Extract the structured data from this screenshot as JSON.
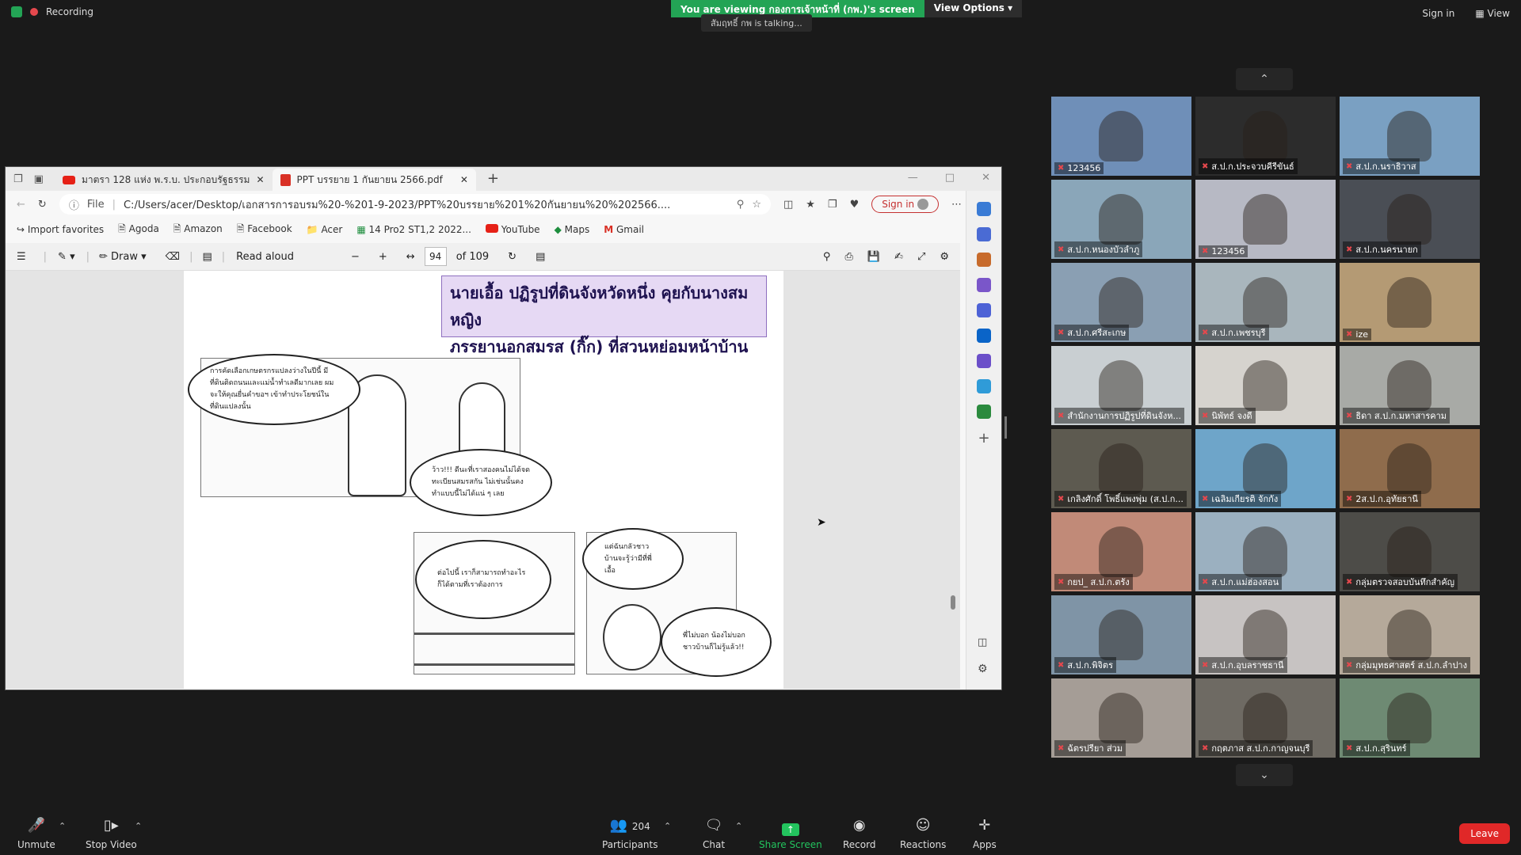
{
  "top": {
    "recording_label": "Recording",
    "banner_view": "You are viewing กองการเจ้าหน้าที่ (กพ.)'s screen",
    "banner_options": "View Options",
    "talking": "สัมฤทธิ์ กพ is talking...",
    "sign_in": "Sign in",
    "view": "View"
  },
  "browser": {
    "tabs": [
      {
        "label": "มาตรา 128 แห่ง พ.ร.บ. ประกอบรัฐธรรม",
        "icon": "youtube-icon"
      },
      {
        "label": "PPT บรรยาย 1 กันยายน 2566.pdf",
        "icon": "pdf-icon"
      }
    ],
    "file_label": "File",
    "url": "C:/Users/acer/Desktop/เอกสารการอบรม%20-%201-9-2023/PPT%20บรรยาย%201%20กันยายน%20%202566....",
    "signin": "Sign in",
    "favorites": [
      "Import favorites",
      "Agoda",
      "Amazon",
      "Facebook",
      "Acer",
      "14 Pro2 ST1,2 2022...",
      "YouTube",
      "Maps",
      "Gmail"
    ],
    "pdf_toolbar": {
      "draw": "Draw",
      "read_aloud": "Read aloud",
      "page_number": "94",
      "page_total": "of 109"
    }
  },
  "slide": {
    "title_line1": "นายเอื้อ ปฏิรูปที่ดินจังหวัดหนึ่ง คุยกับนางสมหญิง",
    "title_line2": "ภรรยานอกสมรส (กิ๊ก) ที่สวนหย่อมหน้าบ้าน",
    "bubble1": "การคัดเลือกเกษตรกรแปลงว่างในปีนี้ มีที่ดินติดถนนและแม่น้ำทำเลดีมากเลย ผมจะให้คุณยื่นคำขอฯ เข้าทำประโยชน์ในที่ดินแปลงนั้น",
    "bubble2": "ว้าว!!! ดีนะที่เราสองคนไม่ได้จดทะเบียนสมรสกัน ไม่เช่นนั้นคงทำแบบนี้ไม่ได้แน่ ๆ เลย",
    "bubble3": "ต่อไปนี้ เราก็สามารถทำอะไรก็ได้ตามที่เราต้องการ",
    "bubble4": "แต่ฉันกลัวชาวบ้านจะรู้ว่ามีที่พี่เอื้อ",
    "bubble5": "พี่ไม่บอก น้องไม่บอก ชาวบ้านก็ไม่รู้แล้ว!!"
  },
  "participants": [
    {
      "name": "123456",
      "color": "#6f8fb8"
    },
    {
      "name": "ส.ป.ก.ประจวบคีรีขันธ์",
      "color": "#2c2c2c"
    },
    {
      "name": "ส.ป.ก.นราธิวาส",
      "color": "#7aa0c2"
    },
    {
      "name": "ส.ป.ก.หนองบัวลำภู",
      "color": "#8aa6b9"
    },
    {
      "name": "123456",
      "color": "#b7b9c4"
    },
    {
      "name": "ส.ป.ก.นครนายก",
      "color": "#4a4e55"
    },
    {
      "name": "ส.ป.ก.ศรีสะเกษ",
      "color": "#8a9fb3"
    },
    {
      "name": "ส.ป.ก.เพชรบุรี",
      "color": "#a9b6bd"
    },
    {
      "name": "ize",
      "color": "#b49a74"
    },
    {
      "name": "สำนักงานการปฏิรูปที่ดินจังห...",
      "color": "#c9cfd2"
    },
    {
      "name": "นิพัทธ์ จงดี",
      "color": "#d6d3ce"
    },
    {
      "name": "ธิดา ส.ป.ก.มหาสารคาม",
      "color": "#a8aaa6"
    },
    {
      "name": "เกลิงศักดิ์ โพธิ์แพงพุ่ม (ส.ป.ก...",
      "color": "#5d5a50"
    },
    {
      "name": "เฉลิมเกียรติ จักกัง",
      "color": "#6ea5c9"
    },
    {
      "name": "2ส.ป.ก.อุทัยธานี",
      "color": "#8f6c4c"
    },
    {
      "name": "กยป_ ส.ป.ก.ตรัง",
      "color": "#c18a78"
    },
    {
      "name": "ส.ป.ก.แม่ฮ่องสอน",
      "color": "#9bb0c0"
    },
    {
      "name": "กลุ่มตรวจสอบบันทึกสำคัญ",
      "color": "#4d4c48"
    },
    {
      "name": "ส.ป.ก.พิจิตร",
      "color": "#7f94a6"
    },
    {
      "name": "ส.ป.ก.อุบลราชธานี",
      "color": "#c7c3c2"
    },
    {
      "name": "กลุ่มมุทธศาสตร์ ส.ป.ก.ลำปาง",
      "color": "#b5a99a"
    },
    {
      "name": "ฉัตรปรียา ส่วม",
      "color": "#a59d96"
    },
    {
      "name": "กฤตภาส ส.ป.ก.กาญจนบุรี",
      "color": "#6e6a63"
    },
    {
      "name": "ส.ป.ก.สุรินทร์",
      "color": "#6e8a73"
    }
  ],
  "controls": {
    "unmute": "Unmute",
    "stop_video": "Stop Video",
    "participants_count": "204",
    "participants": "Participants",
    "chat": "Chat",
    "share_screen": "Share Screen",
    "record": "Record",
    "reactions": "Reactions",
    "apps": "Apps",
    "leave": "Leave"
  }
}
